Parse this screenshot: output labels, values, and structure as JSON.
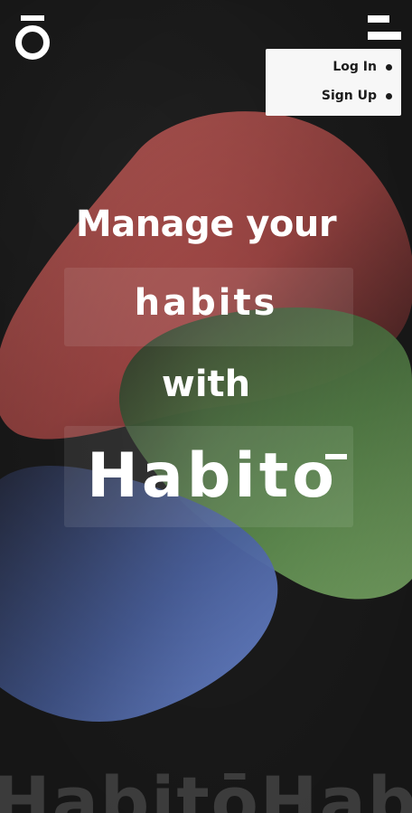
{
  "header": {
    "logo_icon": "habito-logo-icon",
    "menu_icon": "hamburger-menu-icon"
  },
  "dropdown": {
    "items": [
      {
        "label": "Log In"
      },
      {
        "label": "Sign Up"
      }
    ]
  },
  "hero": {
    "line1": "Manage your",
    "line2": "habits",
    "line3": "with",
    "brand": "Habito"
  },
  "background": {
    "watermark": "HabitōHab",
    "colors": {
      "base": "#1d1d1d",
      "red_blob": "#c75b59",
      "green_blob": "#7fb56b",
      "blue_blob": "#6f8fe3"
    }
  }
}
